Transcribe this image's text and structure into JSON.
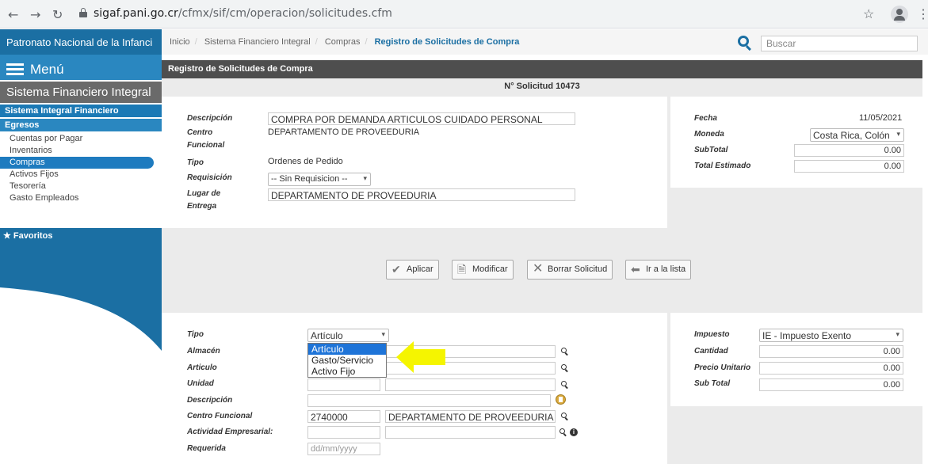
{
  "browser": {
    "url_domain": "sigaf.pani.go.cr",
    "url_path": "/cfmx/sif/cm/operacion/solicitudes.cfm"
  },
  "sidebar": {
    "org_title": "Patronato Nacional de la Infanci",
    "menu_label": "Menú",
    "system_title": "Sistema Financiero Integral",
    "section_sif": "Sistema Integral Financiero",
    "section_egresos": "Egresos",
    "items": [
      {
        "label": "Cuentas por Pagar",
        "active": false
      },
      {
        "label": "Inventarios",
        "active": false
      },
      {
        "label": "Compras",
        "active": true
      },
      {
        "label": "Activos Fijos",
        "active": false
      },
      {
        "label": "Tesorería",
        "active": false
      },
      {
        "label": "Gasto Empleados",
        "active": false
      }
    ],
    "favorites_label": "Favoritos"
  },
  "topbar": {
    "breadcrumb": [
      "Inicio",
      "Sistema Financiero Integral",
      "Compras",
      "Registro de Solicitudes de Compra"
    ],
    "search_placeholder": "Buscar"
  },
  "panel": {
    "title": "Registro de Solicitudes de Compra",
    "solicitud_number": "N° Solicitud 10473"
  },
  "header_form": {
    "descripcion_label": "Descripción",
    "descripcion_value": "COMPRA POR DEMANDA ARTICULOS CUIDADO PERSONAL",
    "centro_label_1": "Centro",
    "centro_label_2": "Funcional",
    "centro_value": "DEPARTAMENTO DE PROVEEDURIA",
    "tipo_label": "Tipo",
    "tipo_value": "Ordenes de Pedido",
    "requisicion_label": "Requisición",
    "requisicion_value": "-- Sin Requisicion --",
    "lugar_label_1": "Lugar de",
    "lugar_label_2": "Entrega",
    "lugar_value": "DEPARTAMENTO DE PROVEEDURIA",
    "fecha_label": "Fecha",
    "fecha_value": "11/05/2021",
    "moneda_label": "Moneda",
    "moneda_value": "Costa Rica, Colón",
    "subtotal_label": "SubTotal",
    "subtotal_value": "0.00",
    "total_label": "Total Estimado",
    "total_value": "0.00"
  },
  "actions": {
    "aplicar": "Aplicar",
    "modificar": "Modificar",
    "borrar": "Borrar Solicitud",
    "ir_lista": "Ir a la lista"
  },
  "line_form": {
    "tipo_label": "Tipo",
    "tipo_value": "Artículo",
    "tipo_options": [
      "Artículo",
      "Gasto/Servicio",
      "Activo Fijo"
    ],
    "almacen_label": "Almacén",
    "articulo_label": "Articulo",
    "unidad_label": "Unidad",
    "descripcion_label": "Descripción",
    "centro_label": "Centro Funcional",
    "centro_code": "2740000",
    "centro_name": "DEPARTAMENTO DE PROVEEDURIA",
    "actividad_label": "Actividad Empresarial:",
    "requerida_label": "Requerida",
    "requerida_placeholder": "dd/mm/yyyy",
    "impuesto_label": "Impuesto",
    "impuesto_value": "IE - Impuesto Exento",
    "cantidad_label": "Cantidad",
    "cantidad_value": "0.00",
    "precio_label": "Precio Unitario",
    "precio_value": "0.00",
    "subtotal_label": "Sub Total",
    "subtotal_value": "0.00"
  },
  "colors": {
    "primary": "#1b6fa3",
    "header_dark": "#4e4e4e",
    "highlight_arrow": "#f5f500",
    "selected_option": "#1e74d8"
  }
}
